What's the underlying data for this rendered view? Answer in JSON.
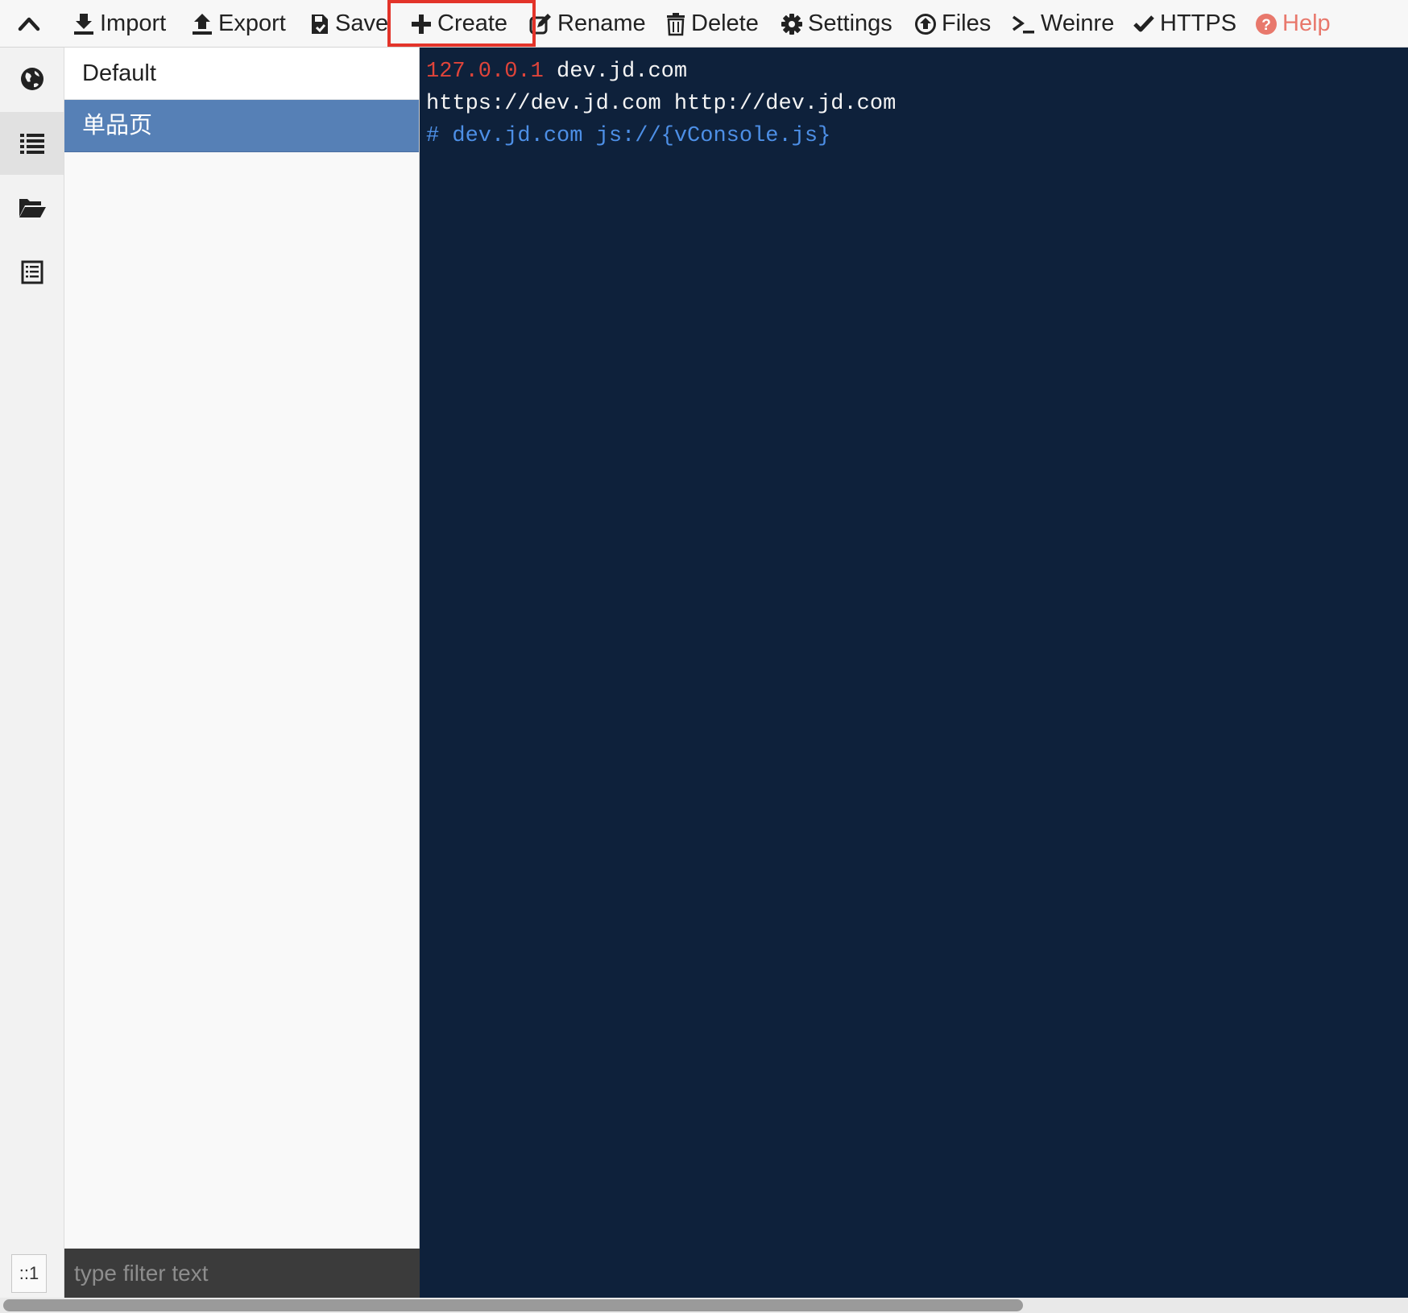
{
  "toolbar": {
    "import": "Import",
    "export": "Export",
    "save": "Save",
    "create": "Create",
    "rename": "Rename",
    "delete": "Delete",
    "settings": "Settings",
    "files": "Files",
    "weinre": "Weinre",
    "https": "HTTPS",
    "help": "Help"
  },
  "rail": {
    "counter": "::1"
  },
  "rules": {
    "items": [
      {
        "label": "Default"
      },
      {
        "label": "单品页"
      }
    ],
    "filter_placeholder": "type filter text"
  },
  "editor": {
    "lines": [
      {
        "ip": "127.0.0.1",
        "text": " dev.jd.com"
      },
      {
        "text": "https://dev.jd.com http://dev.jd.com"
      },
      {
        "comment": "# dev.jd.com js://{vConsole.js}"
      }
    ]
  },
  "colors": {
    "highlight": "#e3342a",
    "selected_item": "#5680b6",
    "editor_bg": "#0e213b",
    "ip": "#e0443a",
    "comment": "#4d8fe6",
    "help": "#e8786c"
  }
}
